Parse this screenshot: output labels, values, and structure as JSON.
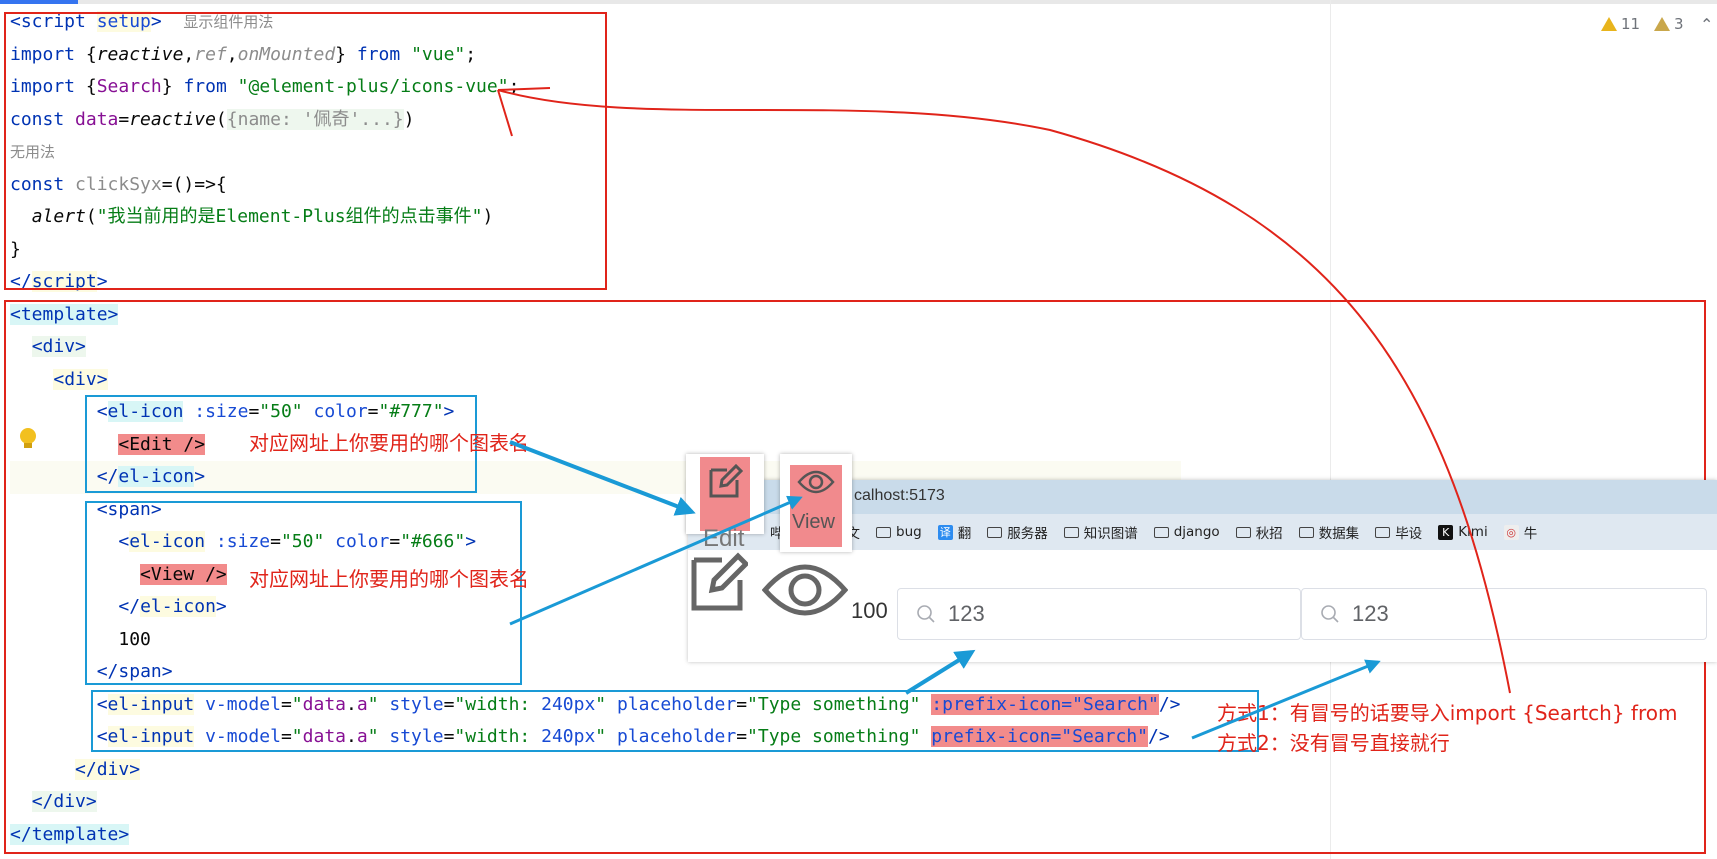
{
  "warnings": {
    "errors": "11",
    "warnings": "3"
  },
  "code": {
    "script_open": "<script",
    "script_setup": "setup",
    "script_close_bracket": ">",
    "script_hint": "显示组件用法",
    "l2_import": "import",
    "l2_open": " {",
    "l2_reactive": "reactive",
    "l2_comma1": ",",
    "l2_ref": "ref",
    "l2_comma2": ",",
    "l2_onmounted": "onMounted",
    "l2_close": "} ",
    "l2_from": "from",
    "l2_str": "\"vue\"",
    "l2_semi": ";",
    "l3_import": "import",
    "l3_open": " {",
    "l3_search": "Search",
    "l3_close": "} ",
    "l3_from": "from",
    "l3_str": "\"@element-plus/icons-vue\"",
    "l3_semi": ";",
    "l4_const": "const",
    "l4_data": " data",
    "l4_eq": "=",
    "l4_reactive": "reactive",
    "l4_paren": "(",
    "l4_fold": "{name: '佩奇'...}",
    "l4_close": ")",
    "unused_hint": "无用法",
    "l6_const": "const",
    "l6_name": " clickSyx",
    "l6_rest": "=()=>{",
    "l7_alert": "alert",
    "l7_paren": "(",
    "l7_str": "\"我当前用的是Element-Plus组件的点击事件\"",
    "l7_close": ")",
    "l8": "}",
    "l9_open": "</",
    "l9_script": "script",
    "l9_close": ">",
    "t_open": "<",
    "t_template": "template",
    "t_gt": ">",
    "div_open": "<",
    "div_tag": "div",
    "div_gt": ">",
    "elicon1_open": "<",
    "elicon1_tag": "el-icon",
    "elicon1_attr1": " :size",
    "elicon1_eq1": "=",
    "elicon1_val1": "\"50\"",
    "elicon1_attr2": " color",
    "elicon1_eq2": "=",
    "elicon1_val2": "\"#777\"",
    "elicon1_gt": ">",
    "edit_tag": "<Edit />",
    "elicon1_close_open": "</",
    "elicon1_close_tag": "el-icon",
    "elicon1_close_gt": ">",
    "span_open": "<",
    "span_tag": "span",
    "span_gt": ">",
    "elicon2_open": "<",
    "elicon2_tag": "el-icon",
    "elicon2_attr1": " :size",
    "elicon2_eq1": "=",
    "elicon2_val1": "\"50\"",
    "elicon2_attr2": " color",
    "elicon2_eq2": "=",
    "elicon2_val2": "\"#666\"",
    "elicon2_gt": ">",
    "view_tag": "<View />",
    "elicon2_close_open": "</",
    "elicon2_close_tag": "el-icon",
    "elicon2_close_gt": ">",
    "hundred": "100",
    "span_close_open": "</",
    "span_close_tag": "span",
    "span_close_gt": ">",
    "input_open": "<",
    "input_tag": "el-input",
    "input_attr1": " v-model",
    "input_eq1": "=",
    "input_val1_q1": "\"",
    "input_val1_data": "data",
    "input_val1_dot": ".",
    "input_val1_a": "a",
    "input_val1_q2": "\"",
    "input_attr2": " style",
    "input_eq2": "=",
    "input_val2_q": "\"width: ",
    "input_val2_px": "240px",
    "input_val2_q2": "\"",
    "input_attr3": " placeholder",
    "input_eq3": "=",
    "input_val3": "\"Type something\"",
    "input1_prefix": ":prefix-icon=\"Search\"",
    "input2_prefix": "prefix-icon=\"Search\"",
    "input_end": "/>",
    "div2_close_open": "</",
    "div2_close_tag": "div",
    "div2_close_gt": ">",
    "div1_close_open": "</",
    "div1_close_tag": "div",
    "div1_close_gt": ">",
    "t_close_open": "</",
    "t_close_tag": "template",
    "t_close_gt": ">"
  },
  "annotations": {
    "edit_note": "对应网址上你要用的哪个图表名",
    "view_note": "对应网址上你要用的哪个图表名",
    "mode1": "方式1：有冒号的话要导入import {Seartch} from",
    "mode2": "方式2：没有冒号直接就行"
  },
  "browser": {
    "url": "calhost:5173",
    "bookmarks": [
      "哔哩",
      "论文",
      "bug",
      "翻",
      "服务器",
      "知识图谱",
      "django",
      "秋招",
      "数据集",
      "毕设",
      "Kimi",
      "牛"
    ],
    "number": "100",
    "input1_value": "123",
    "input2_value": "123"
  },
  "popups": {
    "edit_label": "Edit",
    "view_label": "View"
  },
  "colors": {
    "annotation_red": "#e0241a",
    "box_blue": "#1a9ad6",
    "highlight_red": "#f28b8b"
  }
}
